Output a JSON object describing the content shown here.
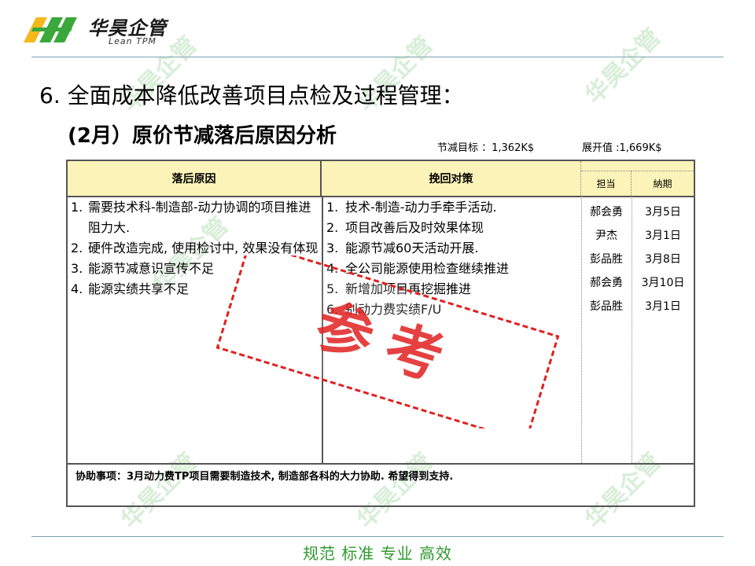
{
  "logo": {
    "name_cn": "华昊企管",
    "name_en": "Lean TPM",
    "colors": {
      "green": "#3aa83a",
      "yellow": "#f2b81c"
    }
  },
  "slide_title": "6. 全面成本降低改善项目点检及过程管理：",
  "sub_title": "(2月）原价节减落后原因分析",
  "metrics": {
    "target": "节减目标 ：1,362K$",
    "expanded": "展开值 :1,669K$"
  },
  "table": {
    "headers": {
      "causes": "落后原因",
      "actions": "挽回对策",
      "owner": "担当",
      "deadline": "納期"
    },
    "causes": [
      {
        "num": "1.",
        "text": "需要技术科-制造部-动力协调的项目推进阻力大."
      },
      {
        "num": "2.",
        "text": "硬件改造完成, 使用检讨中, 效果没有体现"
      },
      {
        "num": "3.",
        "text": "能源节减意识宣传不足"
      },
      {
        "num": "4.",
        "text": "能源实绩共享不足"
      }
    ],
    "actions": [
      {
        "num": "1.",
        "text": "技术-制造-动力手牵手活动."
      },
      {
        "num": "2.",
        "text": "项目改善后及时效果体现"
      },
      {
        "num": "3.",
        "text": "能源节减60天活动开展."
      },
      {
        "num": "4.",
        "text": "全公司能源使用检查继续推进"
      },
      {
        "num": "5.",
        "text": "新增加项目再挖掘推进"
      },
      {
        "num": "6.",
        "text": "别动力费实绩F/U"
      }
    ],
    "owners": [
      "郝会勇",
      "尹杰",
      "彭品胜",
      "郝会勇",
      "彭品胜"
    ],
    "deadlines": [
      "3月5日",
      "3月1日",
      "3月8日",
      "3月10日",
      "3月1日"
    ],
    "assist": "协助事项：3月动力费TP项目需要制造技术, 制造部各科的大力协助. 希望得到支持."
  },
  "stamp": {
    "text": "参考",
    "color": "#e02020"
  },
  "watermark": {
    "text": "华昊企管"
  },
  "tagline": "规范 标准 专业 高效"
}
